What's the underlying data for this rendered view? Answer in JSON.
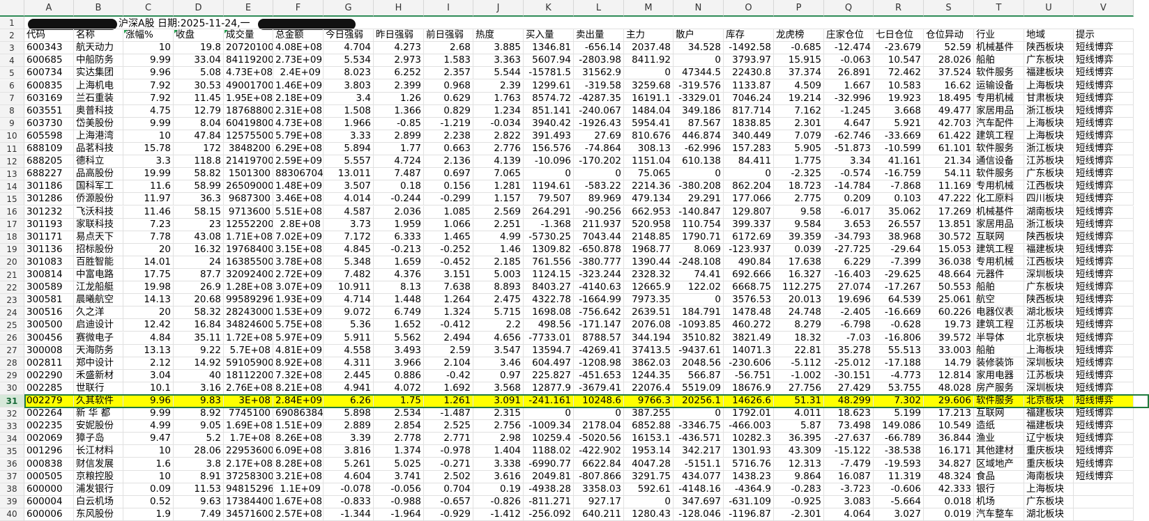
{
  "sheet": {
    "column_letters": [
      "A",
      "B",
      "C",
      "D",
      "E",
      "F",
      "G",
      "H",
      "I",
      "J",
      "K",
      "L",
      "M",
      "N",
      "O",
      "P",
      "Q",
      "R",
      "S",
      "T",
      "U",
      "V"
    ],
    "title_line": "沪深A股  日期:2025-11-24,一",
    "header": [
      "代码",
      "名称",
      "涨幅%",
      "收盘",
      "成交量",
      "总金额",
      "今日强弱",
      "昨日强弱",
      "前日强弱",
      "热度",
      "买入量",
      "卖出量",
      "主力",
      "散户",
      "库存",
      "龙虎榜",
      "庄家仓位",
      "七日仓位",
      "仓位异动",
      "行业",
      "地域",
      "提示"
    ],
    "selected_row": 31,
    "highlight_color": "#ffff00",
    "rows": [
      [
        "600343",
        "航天动力",
        "10",
        "19.8",
        "20720100",
        "4.08E+08",
        "4.704",
        "4.273",
        "2.68",
        "3.885",
        "1346.81",
        "-656.14",
        "2037.48",
        "34.528",
        "-1492.58",
        "-0.685",
        "-12.474",
        "-23.679",
        "52.59",
        "机械基件",
        "陕西板块",
        "短线博弈"
      ],
      [
        "600685",
        "中船防务",
        "9.99",
        "33.04",
        "84119200",
        "2.73E+09",
        "5.534",
        "2.973",
        "1.583",
        "3.363",
        "5607.94",
        "-2803.98",
        "8411.92",
        "0",
        "3793.97",
        "15.915",
        "-0.063",
        "10.547",
        "28.026",
        "船舶",
        "广东板块",
        "短线博弈"
      ],
      [
        "600734",
        "实达集团",
        "9.96",
        "5.08",
        "4.73E+08",
        "2.4E+09",
        "8.023",
        "6.252",
        "2.357",
        "5.544",
        "-15781.5",
        "31562.9",
        "0",
        "47344.5",
        "22430.8",
        "37.374",
        "26.891",
        "72.462",
        "37.524",
        "软件服务",
        "福建板块",
        "短线博弈"
      ],
      [
        "600835",
        "上海机电",
        "7.92",
        "30.53",
        "49001700",
        "1.46E+09",
        "3.803",
        "2.399",
        "0.968",
        "2.39",
        "1299.61",
        "-319.58",
        "3259.68",
        "-319.576",
        "1133.87",
        "4.509",
        "1.667",
        "10.583",
        "16.62",
        "运输设备",
        "上海板块",
        "短线博弈"
      ],
      [
        "603169",
        "兰石重装",
        "7.92",
        "11.45",
        "1.95E+08",
        "2.18E+09",
        "3.4",
        "1.26",
        "0.629",
        "1.763",
        "8574.72",
        "-4287.35",
        "16191.1",
        "-3329.01",
        "7046.24",
        "19.214",
        "-32.996",
        "19.923",
        "18.495",
        "专用机械",
        "甘肃板块",
        "短线博弈"
      ],
      [
        "603551",
        "奥普科技",
        "4.75",
        "12.79",
        "18768800",
        "2.31E+08",
        "1.508",
        "1.366",
        "0.829",
        "1.234",
        "851.141",
        "-240.067",
        "1484.04",
        "349.186",
        "817.714",
        "7.162",
        "-1.245",
        "3.668",
        "49.477",
        "家居用品",
        "浙江板块",
        "短线博弈"
      ],
      [
        "603730",
        "岱美股份",
        "9.99",
        "8.04",
        "60419800",
        "4.73E+08",
        "1.966",
        "-0.85",
        "-1.219",
        "-0.034",
        "3940.42",
        "-1926.43",
        "5954.41",
        "87.567",
        "1838.85",
        "2.301",
        "4.647",
        "5.921",
        "42.703",
        "汽车配件",
        "上海板块",
        "短线博弈"
      ],
      [
        "605598",
        "上海港湾",
        "10",
        "47.84",
        "12575500",
        "5.79E+08",
        "3.33",
        "2.899",
        "2.238",
        "2.822",
        "391.493",
        "27.69",
        "810.676",
        "446.874",
        "340.449",
        "7.079",
        "-62.746",
        "-33.669",
        "61.422",
        "建筑工程",
        "上海板块",
        "短线博弈"
      ],
      [
        "688109",
        "品茗科技",
        "15.78",
        "172",
        "3848200",
        "6.29E+08",
        "5.894",
        "1.77",
        "0.663",
        "2.776",
        "156.576",
        "-74.864",
        "308.13",
        "-62.996",
        "157.283",
        "5.905",
        "-51.873",
        "-10.599",
        "61.101",
        "软件服务",
        "浙江板块",
        "短线博弈"
      ],
      [
        "688205",
        "德科立",
        "3.3",
        "118.8",
        "21419700",
        "2.59E+09",
        "5.557",
        "4.724",
        "2.136",
        "4.139",
        "-10.096",
        "-170.202",
        "1151.04",
        "610.138",
        "84.411",
        "1.775",
        "3.34",
        "41.161",
        "21.34",
        "通信设备",
        "江苏板块",
        "短线博弈"
      ],
      [
        "688227",
        "品高股份",
        "19.99",
        "58.82",
        "1501300",
        "88306704",
        "13.011",
        "7.487",
        "0.697",
        "7.065",
        "0",
        "0",
        "75.065",
        "0",
        "0",
        "-2.325",
        "-0.574",
        "-16.759",
        "54.11",
        "软件服务",
        "广东板块",
        "短线博弈"
      ],
      [
        "301186",
        "国科军工",
        "11.6",
        "58.99",
        "26509000",
        "1.48E+09",
        "3.507",
        "0.18",
        "0.156",
        "1.281",
        "1194.61",
        "-583.22",
        "2214.36",
        "-380.208",
        "862.204",
        "18.723",
        "-14.784",
        "-7.868",
        "11.169",
        "专用机械",
        "江西板块",
        "短线博弈"
      ],
      [
        "301286",
        "侨源股份",
        "11.97",
        "36.3",
        "9687300",
        "3.46E+08",
        "4.014",
        "-0.244",
        "-0.299",
        "1.157",
        "79.507",
        "89.969",
        "479.134",
        "29.291",
        "177.066",
        "2.775",
        "0.209",
        "0.103",
        "47.222",
        "化工原料",
        "四川板块",
        "短线博弈"
      ],
      [
        "301232",
        "飞沃科技",
        "11.46",
        "58.15",
        "9713600",
        "5.51E+08",
        "4.587",
        "2.036",
        "1.085",
        "2.569",
        "264.291",
        "-90.256",
        "662.953",
        "-140.847",
        "129.807",
        "9.58",
        "-6.017",
        "35.062",
        "17.269",
        "机械基件",
        "湖南板块",
        "短线博弈"
      ],
      [
        "301193",
        "家联科技",
        "7.23",
        "23",
        "12552200",
        "2.8E+08",
        "3.73",
        "1.959",
        "1.066",
        "2.251",
        "-1.368",
        "211.937",
        "520.958",
        "110.754",
        "399.337",
        "9.584",
        "3.653",
        "26.557",
        "13.851",
        "家居用品",
        "浙江板块",
        "短线博弈"
      ],
      [
        "301171",
        "易点天下",
        "7.78",
        "43.08",
        "1.71E+08",
        "7.02E+09",
        "7.172",
        "6.333",
        "1.465",
        "4.99",
        "-5730.25",
        "7043.44",
        "2148.85",
        "1790.71",
        "6172.69",
        "39.359",
        "-34.793",
        "38.968",
        "30.572",
        "互联网",
        "陕西板块",
        "短线博弈"
      ],
      [
        "301136",
        "招标股份",
        "20",
        "16.32",
        "19768400",
        "3.15E+08",
        "4.845",
        "-0.213",
        "-0.252",
        "1.46",
        "1309.82",
        "-650.878",
        "1968.77",
        "8.069",
        "-123.937",
        "0.039",
        "-27.725",
        "-29.64",
        "15.053",
        "建筑工程",
        "福建板块",
        "短线博弈"
      ],
      [
        "301083",
        "百胜智能",
        "14.01",
        "24",
        "16385500",
        "3.78E+08",
        "5.348",
        "1.659",
        "-0.452",
        "2.185",
        "761.556",
        "-380.777",
        "1390.44",
        "-248.108",
        "490.84",
        "17.638",
        "6.229",
        "-7.399",
        "36.038",
        "专用机械",
        "江西板块",
        "短线博弈"
      ],
      [
        "300814",
        "中富电路",
        "17.75",
        "87.7",
        "32092400",
        "2.72E+09",
        "7.482",
        "4.376",
        "3.151",
        "5.003",
        "1124.15",
        "-323.244",
        "2328.32",
        "74.41",
        "692.666",
        "16.327",
        "-16.403",
        "-29.625",
        "48.664",
        "元器件",
        "深圳板块",
        "短线博弈"
      ],
      [
        "300589",
        "江龙船艇",
        "19.98",
        "26.9",
        "1.28E+08",
        "3.07E+09",
        "10.911",
        "8.13",
        "7.638",
        "8.893",
        "8403.27",
        "-4140.63",
        "12665.9",
        "122.02",
        "6668.75",
        "112.275",
        "27.074",
        "-17.267",
        "50.553",
        "船舶",
        "广东板块",
        "短线博弈"
      ],
      [
        "300581",
        "晨曦航空",
        "14.13",
        "20.68",
        "99589296",
        "1.93E+09",
        "4.714",
        "1.448",
        "1.264",
        "2.475",
        "4322.78",
        "-1664.99",
        "7973.35",
        "0",
        "3576.53",
        "20.013",
        "19.696",
        "64.539",
        "25.061",
        "航空",
        "陕西板块",
        "短线博弈"
      ],
      [
        "300516",
        "久之洋",
        "20",
        "58.32",
        "28243000",
        "1.53E+09",
        "9.072",
        "6.749",
        "1.324",
        "5.715",
        "1698.08",
        "-756.642",
        "2639.51",
        "184.791",
        "1478.48",
        "24.748",
        "-2.405",
        "-16.669",
        "60.226",
        "电器仪表",
        "湖北板块",
        "短线博弈"
      ],
      [
        "300500",
        "启迪设计",
        "12.42",
        "16.84",
        "34824600",
        "5.75E+08",
        "5.36",
        "1.652",
        "-0.412",
        "2.2",
        "498.56",
        "-171.147",
        "2076.08",
        "-1093.85",
        "460.272",
        "8.279",
        "-6.798",
        "-0.628",
        "19.73",
        "建筑工程",
        "江苏板块",
        "短线博弈"
      ],
      [
        "300456",
        "赛微电子",
        "4.84",
        "35.11",
        "1.72E+08",
        "5.97E+09",
        "5.911",
        "5.562",
        "2.494",
        "4.656",
        "-7733.01",
        "8788.57",
        "344.194",
        "3510.82",
        "3821.49",
        "18.32",
        "-7.03",
        "-16.806",
        "39.572",
        "半导体",
        "北京板块",
        "短线博弈"
      ],
      [
        "300008",
        "天海防务",
        "13.13",
        "9.22",
        "5.7E+08",
        "4.81E+09",
        "4.558",
        "3.493",
        "2.59",
        "3.547",
        "13594.7",
        "-4269.41",
        "37413.5",
        "-9437.61",
        "14071.3",
        "22.81",
        "35.278",
        "55.513",
        "33.003",
        "船舶",
        "上海板块",
        "短线博弈"
      ],
      [
        "002811",
        "郑中设计",
        "2.12",
        "14.92",
        "59105900",
        "8.92E+08",
        "4.311",
        "3.966",
        "2.104",
        "3.46",
        "604.497",
        "-1208.98",
        "3862.03",
        "2048.56",
        "-230.606",
        "-5.112",
        "-25.012",
        "-17.188",
        "14.79",
        "装修装饰",
        "深圳板块",
        "短线博弈"
      ],
      [
        "002290",
        "禾盛新材",
        "3.04",
        "40",
        "18112200",
        "7.32E+08",
        "2.445",
        "0.886",
        "-0.42",
        "0.97",
        "225.827",
        "-451.653",
        "1244.35",
        "566.87",
        "-56.751",
        "-1.002",
        "-30.151",
        "-4.773",
        "12.814",
        "家用电器",
        "江苏板块",
        "短线博弈"
      ],
      [
        "002285",
        "世联行",
        "10.1",
        "3.16",
        "2.76E+08",
        "8.21E+08",
        "4.941",
        "4.072",
        "1.692",
        "3.568",
        "12877.9",
        "-3679.41",
        "22076.4",
        "5519.09",
        "18676.9",
        "27.756",
        "27.429",
        "53.755",
        "48.028",
        "房产服务",
        "深圳板块",
        "短线博弈"
      ],
      [
        "002279",
        "久其软件",
        "9.96",
        "9.83",
        "3E+08",
        "2.84E+09",
        "6.26",
        "1.75",
        "1.261",
        "3.091",
        "-241.161",
        "10248.6",
        "9766.3",
        "20256.1",
        "14626.6",
        "51.31",
        "48.299",
        "7.302",
        "29.606",
        "软件服务",
        "北京板块",
        "短线博弈"
      ],
      [
        "002264",
        "新 华 都",
        "9.99",
        "8.92",
        "7745100",
        "69086384",
        "5.898",
        "2.534",
        "-1.487",
        "2.315",
        "0",
        "0",
        "387.255",
        "0",
        "1792.01",
        "4.011",
        "18.623",
        "5.199",
        "17.213",
        "互联网",
        "福建板块",
        "短线博弈"
      ],
      [
        "002235",
        "安妮股份",
        "4.99",
        "9.05",
        "1.69E+08",
        "1.51E+09",
        "2.889",
        "2.854",
        "2.525",
        "2.756",
        "-1009.34",
        "2178.04",
        "6852.88",
        "-3346.75",
        "-466.003",
        "5.87",
        "73.498",
        "149.086",
        "10.549",
        "造纸",
        "福建板块",
        "短线博弈"
      ],
      [
        "002069",
        "獐子岛",
        "9.47",
        "5.2",
        "1.7E+08",
        "8.26E+08",
        "3.39",
        "2.778",
        "2.771",
        "2.98",
        "10259.4",
        "-5020.56",
        "16153.1",
        "-436.571",
        "10282.3",
        "36.395",
        "-27.637",
        "-66.789",
        "36.844",
        "渔业",
        "辽宁板块",
        "短线博弈"
      ],
      [
        "001296",
        "长江材料",
        "10",
        "28.06",
        "22953600",
        "6.09E+08",
        "3.816",
        "1.374",
        "-0.978",
        "1.404",
        "1188.02",
        "-422.902",
        "1953.14",
        "342.217",
        "1301.93",
        "43.309",
        "-15.122",
        "-38.538",
        "16.171",
        "其他建材",
        "重庆板块",
        "短线博弈"
      ],
      [
        "000838",
        "财信发展",
        "1.6",
        "3.8",
        "2.17E+08",
        "8.28E+08",
        "5.261",
        "5.025",
        "-0.271",
        "3.338",
        "-6990.77",
        "6622.84",
        "4047.28",
        "-5151.1",
        "5716.76",
        "12.313",
        "-7.479",
        "-19.593",
        "34.827",
        "区域地产",
        "重庆板块",
        "短线博弈"
      ],
      [
        "000505",
        "京粮控股",
        "10",
        "8.91",
        "37258300",
        "3.21E+08",
        "4.604",
        "3.741",
        "2.502",
        "3.616",
        "2049.81",
        "-807.866",
        "3291.75",
        "434.077",
        "1438.23",
        "9.864",
        "16.087",
        "11.319",
        "48.324",
        "食品",
        "海南板块",
        "短线博弈"
      ],
      [
        "600000",
        "浦发银行",
        "0.09",
        "11.53",
        "94815296",
        "1.1E+09",
        "-0.078",
        "-0.056",
        "0.704",
        "0.19",
        "-4938.28",
        "3358.03",
        "592.61",
        "-4148.16",
        "-4364.9",
        "-0.283",
        "-3.723",
        "-0.606",
        "42.333",
        "银行",
        "上海板块",
        ""
      ],
      [
        "600004",
        "白云机场",
        "0.52",
        "9.63",
        "17384400",
        "1.67E+08",
        "-0.833",
        "-0.988",
        "-0.657",
        "-0.826",
        "-811.271",
        "927.17",
        "0",
        "347.697",
        "-631.109",
        "-0.925",
        "3.083",
        "-5.664",
        "0.018",
        "机场",
        "广东板块",
        ""
      ],
      [
        "600006",
        "东风股份",
        "1.9",
        "7.49",
        "34571600",
        "2.57E+08",
        "-1.344",
        "-1.964",
        "-0.929",
        "-1.412",
        "-256.092",
        "640.211",
        "1280.43",
        "-128.046",
        "-1196.87",
        "-2.301",
        "4.064",
        "3.027",
        "0.019",
        "汽车整车",
        "湖北板块",
        ""
      ]
    ]
  }
}
